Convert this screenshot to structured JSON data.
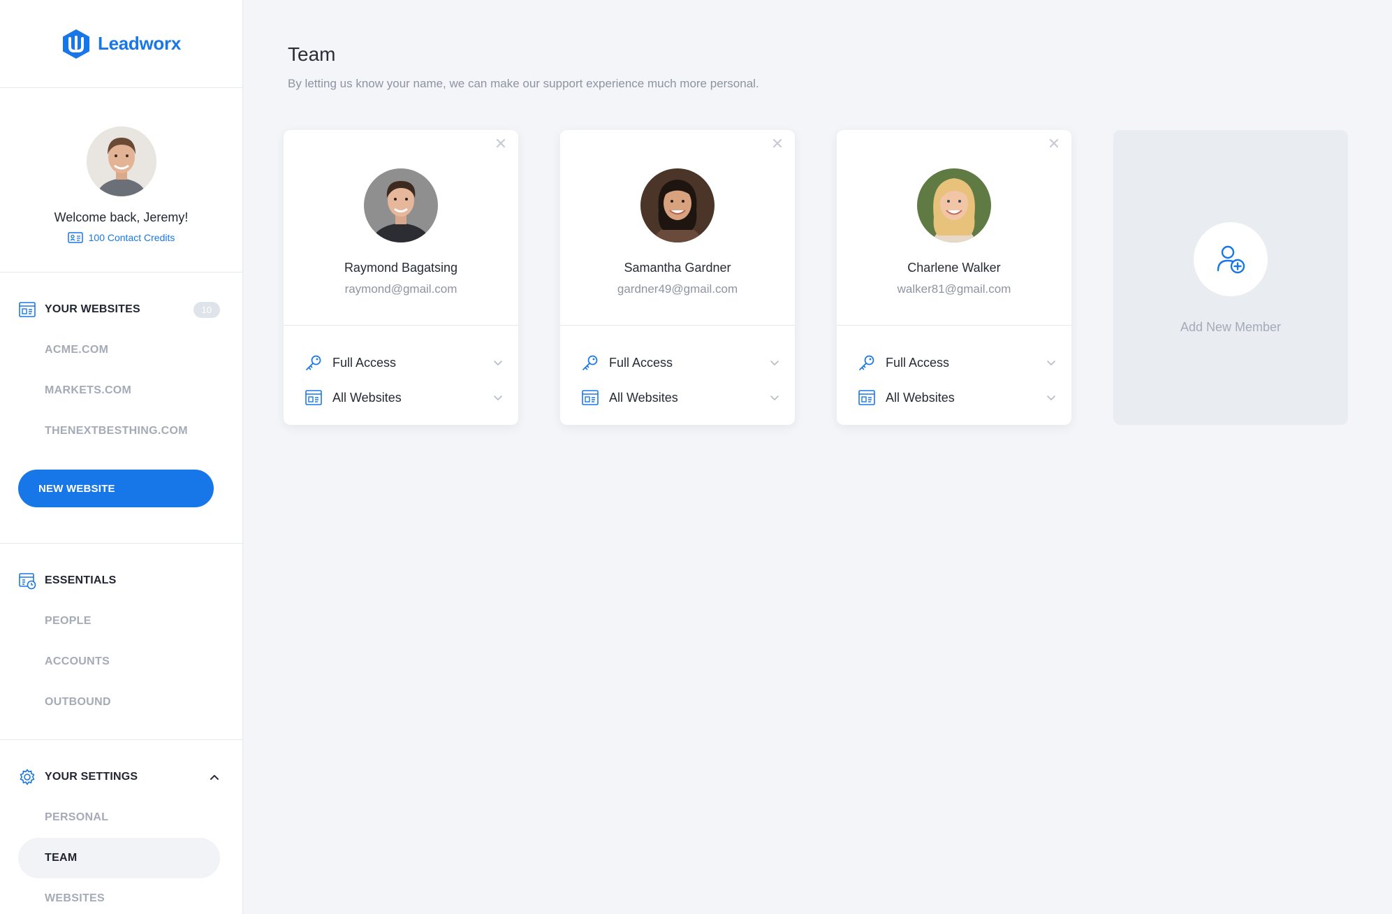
{
  "brand": {
    "name": "Leadworx"
  },
  "profile": {
    "welcome": "Welcome back, Jeremy!",
    "credits": "100 Contact Credits"
  },
  "websites": {
    "heading": "YOUR WEBSITES",
    "count": "10",
    "items": [
      "ACME.COM",
      "MARKETS.COM",
      "THENEXTBESTHING.COM"
    ],
    "new_button": "NEW WEBSITE"
  },
  "essentials": {
    "heading": "ESSENTIALS",
    "items": [
      "PEOPLE",
      "ACCOUNTS",
      "OUTBOUND"
    ]
  },
  "settings": {
    "heading": "YOUR SETTINGS",
    "items": [
      "PERSONAL",
      "TEAM",
      "WEBSITES"
    ],
    "active": "TEAM"
  },
  "page": {
    "title": "Team",
    "subtitle": "By letting us know your name, we can make our support experience much more personal."
  },
  "members": [
    {
      "name": "Raymond Bagatsing",
      "email": "raymond@gmail.com",
      "access": "Full Access",
      "websites": "All Websites"
    },
    {
      "name": "Samantha Gardner",
      "email": "gardner49@gmail.com",
      "access": "Full Access",
      "websites": "All Websites"
    },
    {
      "name": "Charlene Walker",
      "email": "walker81@gmail.com",
      "access": "Full Access",
      "websites": "All Websites"
    }
  ],
  "add_member": {
    "label": "Add New Member"
  },
  "colors": {
    "accent": "#1877e8",
    "sidebar_bg": "#ffffff",
    "main_bg": "#f4f5f8",
    "muted_text": "#a4abb7"
  },
  "icons": {
    "close": "close-icon",
    "access": "key-icon",
    "websites": "browser-icon",
    "caret": "chevron-down-icon",
    "add": "user-plus-icon"
  }
}
